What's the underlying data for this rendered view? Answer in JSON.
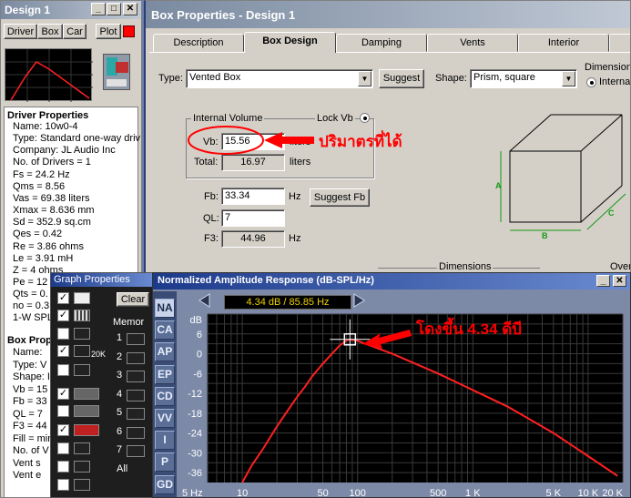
{
  "design_window": {
    "title": "Design 1",
    "toolbar": [
      "Driver",
      "Box",
      "Car",
      "Plot"
    ],
    "driver_properties_heading": "Driver Properties",
    "driver_lines": [
      "Name: 10w0-4",
      "Type: Standard one-way driv",
      "Company: JL Audio Inc",
      "No. of Drivers = 1",
      "Fs = 24.2 Hz",
      "Qms = 8.56",
      "Vas = 69.38 liters",
      "Xmax = 8.636 mm",
      "Sd = 352.9 sq.cm",
      "Qes = 0.42",
      "Re = 3.86 ohms",
      "Le = 3.91 mH",
      "Z = 4 ohms",
      "Pe = 12",
      "Qts = 0.",
      "no = 0.3",
      "1-W SPL"
    ],
    "box_properties_heading": "Box Prop",
    "box_lines": [
      "Name:",
      "Type: V",
      "Shape: I",
      "Vb = 15",
      "Fb = 33",
      "QL = 7",
      "F3 = 44",
      "Fill = min",
      "No. of V",
      "Vent s",
      "Vent e"
    ]
  },
  "box_properties": {
    "title": "Box Properties - Design 1",
    "tabs": [
      "Description",
      "Box Design",
      "Damping",
      "Vents",
      "Interior"
    ],
    "active_tab": "Box Design",
    "type_label": "Type:",
    "type_value": "Vented Box",
    "suggest_label": "Suggest",
    "shape_label": "Shape:",
    "shape_value": "Prism, square",
    "dimensions_label": "Dimensions",
    "internal_radio": "Internal",
    "internal_volume_label": "Internal Volume",
    "lock_vb_label": "Lock Vb",
    "vb_label": "Vb:",
    "vb_value": "15.56",
    "vb_unit": "liters",
    "total_label": "Total:",
    "total_value": "16.97",
    "total_unit": "liters",
    "fb_label": "Fb:",
    "fb_value": "33.34",
    "fb_unit": "Hz",
    "suggest_fb_label": "Suggest Fb",
    "ql_label": "QL:",
    "ql_value": "7",
    "f3_label": "F3:",
    "f3_value": "44.96",
    "f3_unit": "Hz",
    "dim_letters": [
      "A",
      "B",
      "C"
    ],
    "dimensions_bottom": "Dimensions",
    "over_label": "Over"
  },
  "graph_properties": {
    "title": "Graph Properties",
    "clear_label": "Clear",
    "memory_label": "Memor",
    "memory_slots": [
      "1",
      "2",
      "3",
      "4",
      "5",
      "6",
      "7"
    ],
    "all_label": "All",
    "glyph_20k": "20K"
  },
  "amplitude_window": {
    "title": "Normalized Amplitude Response (dB-SPL/Hz)",
    "readout": "4.34 dB / 85.85 Hz",
    "side_tabs": [
      "NA",
      "CA",
      "AP",
      "EP",
      "CD",
      "VV",
      "I",
      "P",
      "GD"
    ],
    "active_side_tab": "NA",
    "colors": {
      "curve": "#ff2020",
      "grid": "#3a3a3a",
      "plot_bg": "#000000"
    }
  },
  "annotations": {
    "volume_note": "ปริมาตรที่ได้",
    "peak_note": "โดงขึ้น 4.34 ดีบี",
    "color": "#ff0000"
  },
  "chart_data": {
    "type": "line",
    "title": "Normalized Amplitude Response (dB-SPL/Hz)",
    "xlabel": "",
    "ylabel": "dB",
    "x_scale": "log",
    "xlim": [
      5,
      20000
    ],
    "ylim": [
      -39,
      12
    ],
    "x_tick_labels": [
      "5 Hz",
      "10",
      "50",
      "100",
      "500",
      "1 K",
      "5 K",
      "10 K",
      "20 K"
    ],
    "x_ticks": [
      5,
      10,
      50,
      100,
      500,
      1000,
      5000,
      10000,
      20000
    ],
    "y_tick_labels": [
      "6",
      "0",
      "-6",
      "-12",
      "-18",
      "-24",
      "-30",
      "-36"
    ],
    "y_ticks": [
      6,
      0,
      -6,
      -12,
      -18,
      -24,
      -30,
      -36
    ],
    "grid": true,
    "series": [
      {
        "x": [
          10,
          12,
          15,
          20,
          25,
          30,
          35,
          40,
          50,
          60,
          70,
          80,
          85.85,
          100,
          200,
          500,
          1000,
          2000,
          5000,
          10000,
          18000
        ],
        "y": [
          -39,
          -34,
          -29,
          -22,
          -17,
          -13,
          -10,
          -7,
          -3,
          0,
          2.5,
          4,
          4.34,
          3.9,
          0,
          -6,
          -11,
          -16,
          -24,
          -31,
          -37
        ]
      }
    ],
    "cursor": {
      "x": 85.85,
      "y": 4.34
    }
  }
}
